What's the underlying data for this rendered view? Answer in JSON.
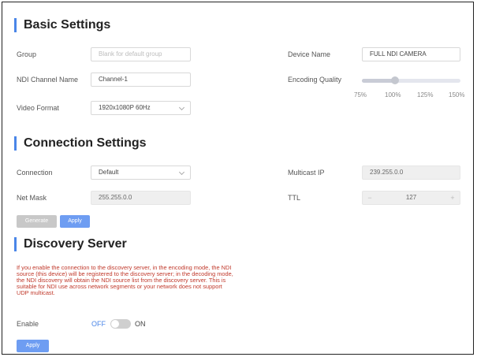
{
  "basic": {
    "title": "Basic Settings",
    "group_label": "Group",
    "group_placeholder": "Blank for default group",
    "device_name_label": "Device Name",
    "device_name_value": "FULL NDI CAMERA",
    "ndi_channel_label": "NDI Channel Name",
    "ndi_channel_value": "Channel-1",
    "encoding_quality_label": "Encoding Quality",
    "encoding_quality_ticks": [
      "75%",
      "100%",
      "125%",
      "150%"
    ],
    "encoding_quality_value_percent": 100,
    "video_format_label": "Video Format",
    "video_format_value": "1920x1080P 60Hz"
  },
  "connection": {
    "title": "Connection Settings",
    "connection_label": "Connection",
    "connection_value": "Default",
    "multicast_ip_label": "Multicast IP",
    "multicast_ip_value": "239.255.0.0",
    "net_mask_label": "Net Mask",
    "net_mask_value": "255.255.0.0",
    "ttl_label": "TTL",
    "ttl_value": "127",
    "ttl_minus": "−",
    "ttl_plus": "+",
    "generate_label": "Generate",
    "apply_label": "Apply"
  },
  "discovery": {
    "title": "Discovery Server",
    "notice": "If you enable the connection to the discovery server, in the encoding mode, the NDI source (this device) will be registered to the discovery server; in the decoding mode, the NDI discovery will obtain the NDI source list from the discovery server. This is suitable for NDI use across network segments or your network does not support UDP multicast.",
    "enable_label": "Enable",
    "off_label": "OFF",
    "on_label": "ON",
    "enabled": false,
    "apply_label": "Apply"
  },
  "colors": {
    "accent": "#4a86e8",
    "button_blue": "#6e9df2",
    "notice_red": "#c0392b",
    "off_blue": "#4a86e8"
  }
}
